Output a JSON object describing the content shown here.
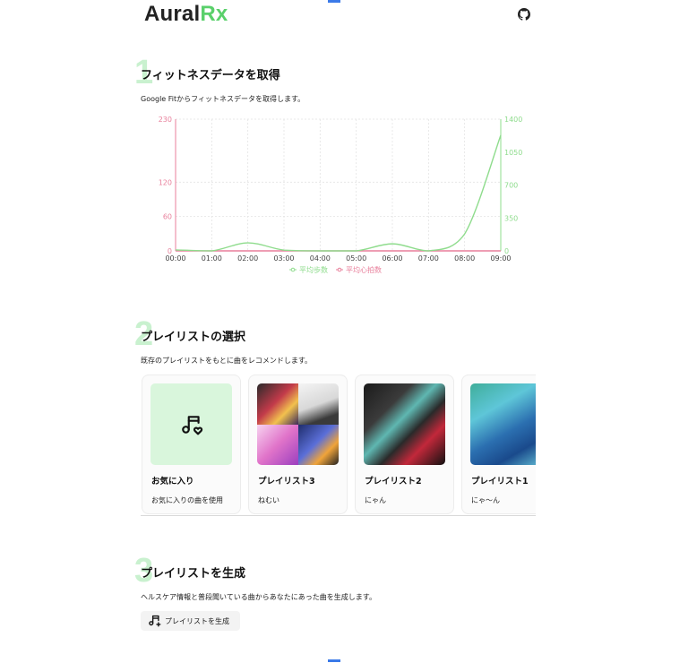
{
  "app": {
    "brand_part1": "Aural",
    "brand_part2": "Rx"
  },
  "colors": {
    "accent": "#5ad06b",
    "steps_series": "#8fdc8d",
    "heart_series": "#e87f9b",
    "scroll_marker": "#3b7ae8"
  },
  "header": {
    "github_icon": "github-icon"
  },
  "section1": {
    "number": "1",
    "title": "フィットネスデータを取得",
    "description": "Google Fitからフィットネスデータを取得します。"
  },
  "chart_data": {
    "type": "line",
    "x": [
      "00:00",
      "01:00",
      "02:00",
      "03:00",
      "04:00",
      "05:00",
      "06:00",
      "07:00",
      "08:00",
      "09:00"
    ],
    "series": [
      {
        "name": "平均歩数",
        "axis": "right",
        "color": "#8fdc8d",
        "values": [
          10,
          0,
          85,
          8,
          0,
          0,
          75,
          0,
          180,
          1230
        ]
      },
      {
        "name": "平均心拍数",
        "axis": "left",
        "color": "#e87f9b",
        "values": [
          0,
          0,
          0,
          0,
          0,
          0,
          0,
          0,
          0,
          0
        ]
      }
    ],
    "y_left": {
      "ticks": [
        0,
        60,
        120,
        230
      ],
      "range": [
        0,
        230
      ]
    },
    "y_right": {
      "ticks": [
        0,
        350,
        700,
        1050,
        1400
      ],
      "range": [
        0,
        1400
      ]
    },
    "grid": true,
    "legend_placement": "bottom"
  },
  "section2": {
    "number": "2",
    "title": "プレイリストの選択",
    "description": "既存のプレイリストをもとに曲をレコメンドします。",
    "cards": [
      {
        "name": "お気に入り",
        "sub": "お気に入りの曲を使用",
        "icon": "music-heart-icon"
      },
      {
        "name": "プレイリスト3",
        "sub": "ねむい"
      },
      {
        "name": "プレイリスト2",
        "sub": "にゃん"
      },
      {
        "name": "プレイリスト1",
        "sub": "にゃ〜ん"
      }
    ]
  },
  "section3": {
    "number": "3",
    "title": "プレイリストを生成",
    "description": "ヘルスケア情報と普段聞いている曲からあなたにあった曲を生成します。",
    "button_label": "プレイリストを生成",
    "button_icon": "music-plus-icon"
  }
}
